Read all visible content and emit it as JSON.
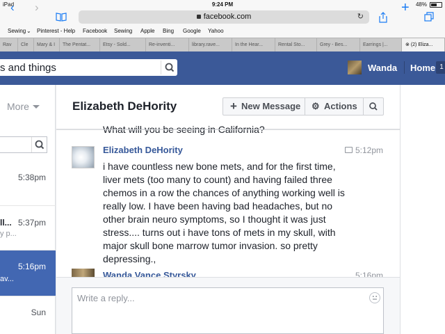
{
  "status": {
    "device": "iPad",
    "time": "9:24 PM",
    "battery": "48%",
    "battery_level": 0.48
  },
  "browser": {
    "url": "facebook.com",
    "bookmarks": [
      "Sewing",
      "Pinterest - Help",
      "Facebook",
      "Sewing",
      "Apple",
      "Bing",
      "Google",
      "Yahoo"
    ],
    "tabs": [
      "Rav",
      "Cle",
      "Mary & I",
      "The Pentat...",
      "Etsy - Sold...",
      "Re-inventi...",
      "library.rave...",
      "In the Hear...",
      "Rental Sto...",
      "Grey - Bes...",
      "Earrings |...",
      "(2) Eliza..."
    ]
  },
  "fb": {
    "search_text": "s and things",
    "user_name": "Wanda",
    "home_label": "Home",
    "home_count": "1",
    "more_label": "More"
  },
  "conversations": [
    {
      "time": "5:38pm",
      "name": "",
      "snippet": ""
    },
    {
      "time": "5:37pm",
      "name": "ll...",
      "snippet": "y p..."
    },
    {
      "time": "5:16pm",
      "name": "",
      "snippet": "av..."
    },
    {
      "time": "Sun",
      "name": "",
      "snippet": ""
    }
  ],
  "thread": {
    "title": "Elizabeth DeHority",
    "new_message_label": "New Message",
    "actions_label": "Actions",
    "prev_text": "What will you be seeing in California?",
    "message": {
      "sender": "Elizabeth DeHority",
      "time": "5:12pm",
      "lines": [
        "i have countless new bone mets, and for the first time,",
        "liver mets (too many to count) and having failed three",
        "chemos in a row the chances of anything working well is",
        "really low.  I have been having bad headaches, but no",
        "other brain neuro symptoms, so I thought it was just",
        "stress.... turns out i have tons of mets in my skull, with",
        "major skull bone marrow tumor invasion.  so pretty",
        "depressing.,"
      ]
    },
    "next_message": {
      "sender": "Wanda Vance Styrsky",
      "time": "5:16pm"
    },
    "reply_placeholder": "Write a reply..."
  }
}
